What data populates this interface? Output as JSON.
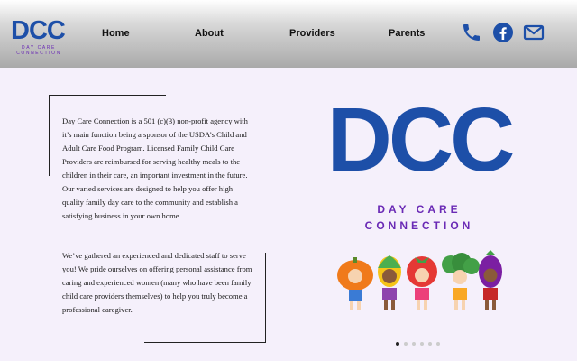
{
  "header": {
    "logo": {
      "main": "DCC",
      "sub": "DAY CARE CONNECTION"
    },
    "nav": [
      {
        "label": "Home"
      },
      {
        "label": "About"
      },
      {
        "label": "Providers"
      },
      {
        "label": "Parents"
      }
    ],
    "icons": [
      "phone-icon",
      "facebook-icon",
      "mail-icon"
    ],
    "icon_color": "#1d4fa8"
  },
  "main": {
    "paragraph1": "Day Care Connection is a 501 (c)(3) non-profit agency with it’s main function being a sponsor of the USDA’s Child and Adult Care Food Program. Licensed Family Child Care Providers are reimbursed for serving healthy meals to the children in their care, an important investment in the future. Our varied services are designed to help you offer high quality family day care to the community and establish a satisfying business in your own home.",
    "paragraph2": "We’ve gathered an experienced and dedicated staff to serve you! We pride ourselves on offering personal assistance from caring and experienced women (many who have been family child care providers themselves) to help you truly become a professional caregiver.",
    "hero_logo": {
      "main": "DCC",
      "line1": "DAY CARE",
      "line2": "CONNECTION"
    },
    "carousel": {
      "count": 6,
      "active": 1
    }
  },
  "colors": {
    "brand_blue": "#1d4fa8",
    "brand_purple": "#6a2ab5",
    "background": "#f5f0fb"
  }
}
